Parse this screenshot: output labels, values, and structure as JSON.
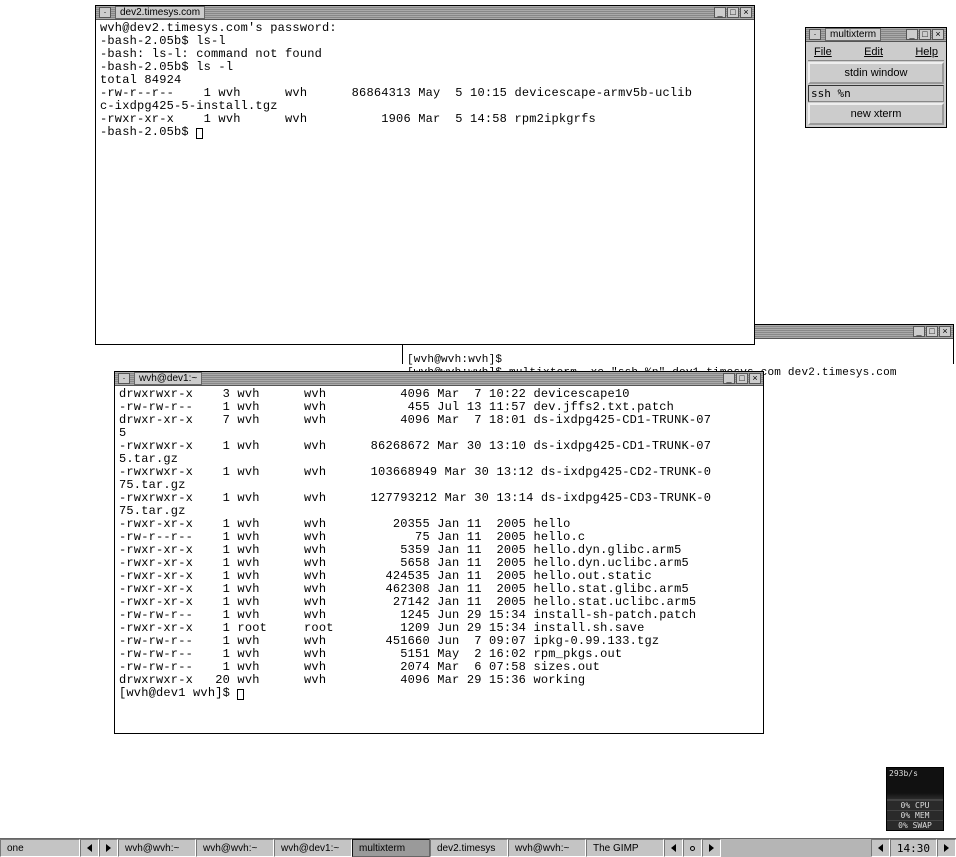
{
  "dev2": {
    "title": "dev2.timesys.com",
    "lines": [
      "wvh@dev2.timesys.com's password:",
      "-bash-2.05b$ ls-l",
      "-bash: ls-l: command not found",
      "-bash-2.05b$ ls -l",
      "total 84924",
      "-rw-r--r--    1 wvh      wvh      86864313 May  5 10:15 devicescape-armv5b-uclib",
      "c-ixdpg425-5-install.tgz",
      "-rwxr-xr-x    1 wvh      wvh          1906 Mar  5 14:58 rpm2ipkgrfs",
      "-bash-2.05b$ "
    ]
  },
  "bgterm": {
    "prompt1": "[wvh@wvh:wvh]$",
    "cmd": "[wvh@wvh:wvh]$ multixterm -xc \"ssh %n\" dev1.timesys.com dev2.timesys.com"
  },
  "dev1": {
    "title": "wvh@dev1:~",
    "lines": [
      "drwxrwxr-x    3 wvh      wvh          4096 Mar  7 10:22 devicescape10",
      "-rw-rw-r--    1 wvh      wvh           455 Jul 13 11:57 dev.jffs2.txt.patch",
      "drwxr-xr-x    7 wvh      wvh          4096 Mar  7 18:01 ds-ixdpg425-CD1-TRUNK-07",
      "5",
      "-rwxrwxr-x    1 wvh      wvh      86268672 Mar 30 13:10 ds-ixdpg425-CD1-TRUNK-07",
      "5.tar.gz",
      "-rwxrwxr-x    1 wvh      wvh      103668949 Mar 30 13:12 ds-ixdpg425-CD2-TRUNK-0",
      "75.tar.gz",
      "-rwxrwxr-x    1 wvh      wvh      127793212 Mar 30 13:14 ds-ixdpg425-CD3-TRUNK-0",
      "75.tar.gz",
      "-rwxr-xr-x    1 wvh      wvh         20355 Jan 11  2005 hello",
      "-rw-r--r--    1 wvh      wvh            75 Jan 11  2005 hello.c",
      "-rwxr-xr-x    1 wvh      wvh          5359 Jan 11  2005 hello.dyn.glibc.arm5",
      "-rwxr-xr-x    1 wvh      wvh          5658 Jan 11  2005 hello.dyn.uclibc.arm5",
      "-rwxr-xr-x    1 wvh      wvh        424535 Jan 11  2005 hello.out.static",
      "-rwxr-xr-x    1 wvh      wvh        462308 Jan 11  2005 hello.stat.glibc.arm5",
      "-rwxr-xr-x    1 wvh      wvh         27142 Jan 11  2005 hello.stat.uclibc.arm5",
      "-rw-rw-r--    1 wvh      wvh          1245 Jun 29 15:34 install-sh-patch.patch",
      "-rwxr-xr-x    1 root     root         1209 Jun 29 15:34 install.sh.save",
      "-rw-rw-r--    1 wvh      wvh        451660 Jun  7 09:07 ipkg-0.99.133.tgz",
      "-rw-rw-r--    1 wvh      wvh          5151 May  2 16:02 rpm_pkgs.out",
      "-rw-rw-r--    1 wvh      wvh          2074 Mar  6 07:58 sizes.out",
      "drwxrwxr-x   20 wvh      wvh          4096 Mar 29 15:36 working",
      "[wvh@dev1 wvh]$ "
    ]
  },
  "multixterm": {
    "title": "multixterm",
    "menu": {
      "file": "File",
      "edit": "Edit",
      "help": "Help"
    },
    "stdin_btn": "stdin window",
    "entry_value": "ssh %n",
    "newxterm_btn": "new xterm"
  },
  "sysmon": {
    "rate": "293b/s",
    "cpu": "0% CPU",
    "mem": "0% MEM",
    "swap": "0% SWAP"
  },
  "taskbar": {
    "workspace": "one",
    "apps": [
      {
        "label": "wvh@wvh:~",
        "active": false
      },
      {
        "label": "wvh@wvh:~",
        "active": false
      },
      {
        "label": "wvh@dev1:~",
        "active": false
      },
      {
        "label": "multixterm",
        "active": true
      },
      {
        "label": "dev2.timesys",
        "active": false
      },
      {
        "label": "wvh@wvh:~",
        "active": false
      },
      {
        "label": "The GIMP",
        "active": false
      }
    ],
    "clock": "14:30"
  }
}
